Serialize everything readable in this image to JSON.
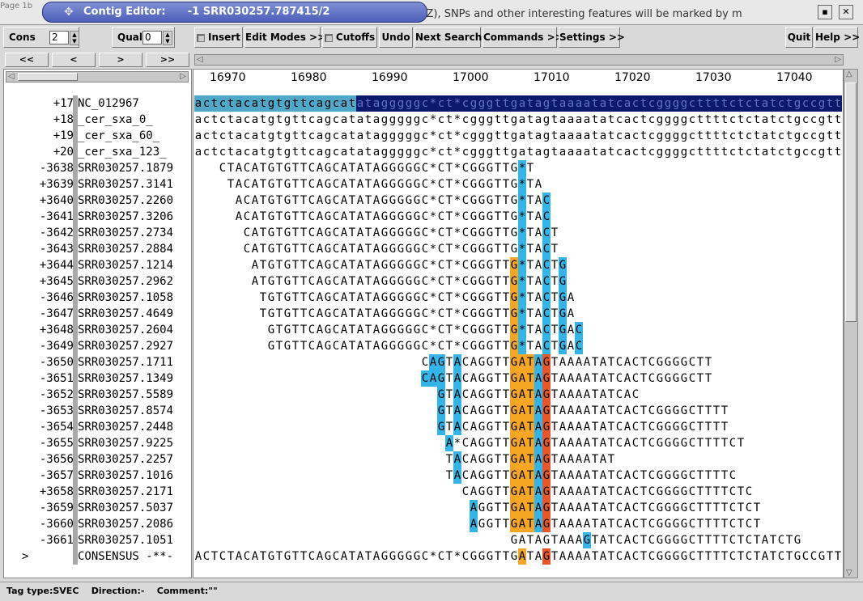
{
  "window": {
    "title": "Contig Editor:",
    "subtitle": "-1 SRR030257.787415/2",
    "background_text": "SEZ), SNPs and other interesting features will be marked by m",
    "background_left": "Page 1b"
  },
  "toolbar": {
    "cons_label": "Cons",
    "cons_value": "2",
    "qual_label": "Qual",
    "qual_value": "0",
    "insert_label": "Insert",
    "edit_modes_label": "Edit Modes >>",
    "cutoffs_label": "Cutoffs",
    "undo_label": "Undo",
    "next_search_label": "Next Search",
    "commands_label": "Commands >>",
    "settings_label": "Settings >>",
    "quit_label": "Quit",
    "help_label": "Help >>"
  },
  "nav": {
    "first": "<<",
    "prev": "<",
    "next": ">",
    "last": ">>"
  },
  "ruler": {
    "ticks": [
      "16970",
      "16980",
      "16990",
      "17000",
      "17010",
      "17020",
      "17030",
      "17040"
    ]
  },
  "rows": [
    {
      "num": "+17",
      "name": "NC_012967",
      "offset": 0,
      "seq": "actctacatgtgttcagcatatagggggc*ct*cgggttgatagtaaaatatcactcggggcttttctctatctgccgtt",
      "hl": [
        [
          0,
          20,
          "#4fa8c8"
        ],
        [
          20,
          81,
          "#0b1a6a"
        ]
      ],
      "color": "#000000"
    },
    {
      "num": "+18",
      "name": "_cer_sxa_0_",
      "offset": 0,
      "seq": "actctacatgtgttcagcatatagggggc*ct*cgggttgatagtaaaatatcactcggggcttttctctatctgccgtt",
      "hl": []
    },
    {
      "num": "+19",
      "name": "_cer_sxa_60_",
      "offset": 0,
      "seq": "actctacatgtgttcagcatatagggggc*ct*cgggttgatagtaaaatatcactcggggcttttctctatctgccgtt",
      "hl": []
    },
    {
      "num": "+20",
      "name": "_cer_sxa_123_",
      "offset": 0,
      "seq": "actctacatgtgttcagcatatagggggc*ct*cgggttgatagtaaaatatcactcggggcttttctctatctgccgtt",
      "hl": []
    },
    {
      "num": "-3638",
      "name": "SRR030257.1879",
      "offset": 3,
      "seq": "CTACATGTGTTCAGCATATAGGGGGC*CT*CGGGTTG*T",
      "hl": [
        [
          37,
          38,
          "#33b5e8"
        ]
      ]
    },
    {
      "num": "+3639",
      "name": "SRR030257.3141",
      "offset": 4,
      "seq": "TACATGTGTTCAGCATATAGGGGGC*CT*CGGGTTG*TA",
      "hl": [
        [
          36,
          37,
          "#33b5e8"
        ]
      ]
    },
    {
      "num": "+3640",
      "name": "SRR030257.2260",
      "offset": 5,
      "seq": "ACATGTGTTCAGCATATAGGGGGC*CT*CGGGTTG*TAC",
      "hl": [
        [
          35,
          36,
          "#33b5e8"
        ],
        [
          38,
          39,
          "#33b5e8"
        ]
      ]
    },
    {
      "num": "-3641",
      "name": "SRR030257.3206",
      "offset": 5,
      "seq": "ACATGTGTTCAGCATATAGGGGGC*CT*CGGGTTG*TAC",
      "hl": [
        [
          35,
          36,
          "#33b5e8"
        ],
        [
          38,
          39,
          "#33b5e8"
        ]
      ]
    },
    {
      "num": "-3642",
      "name": "SRR030257.2734",
      "offset": 6,
      "seq": "CATGTGTTCAGCATATAGGGGGC*CT*CGGGTTG*TACT",
      "hl": [
        [
          34,
          35,
          "#33b5e8"
        ],
        [
          37,
          38,
          "#33b5e8"
        ]
      ]
    },
    {
      "num": "-3643",
      "name": "SRR030257.2884",
      "offset": 6,
      "seq": "CATGTGTTCAGCATATAGGGGGC*CT*CGGGTTG*TACT",
      "hl": [
        [
          34,
          35,
          "#33b5e8"
        ],
        [
          37,
          38,
          "#33b5e8"
        ]
      ]
    },
    {
      "num": "+3644",
      "name": "SRR030257.1214",
      "offset": 7,
      "seq": "ATGTGTTCAGCATATAGGGGGC*CT*CGGGTTG*TACTG",
      "hl": [
        [
          32,
          33,
          "#f5a623"
        ],
        [
          33,
          34,
          "#33b5e8"
        ],
        [
          36,
          37,
          "#33b5e8"
        ],
        [
          38,
          39,
          "#33b5e8"
        ]
      ]
    },
    {
      "num": "+3645",
      "name": "SRR030257.2962",
      "offset": 7,
      "seq": "ATGTGTTCAGCATATAGGGGGC*CT*CGGGTTG*TACTG",
      "hl": [
        [
          32,
          33,
          "#f5a623"
        ],
        [
          33,
          34,
          "#33b5e8"
        ],
        [
          36,
          37,
          "#33b5e8"
        ],
        [
          38,
          39,
          "#33b5e8"
        ]
      ]
    },
    {
      "num": "-3646",
      "name": "SRR030257.1058",
      "offset": 8,
      "seq": "TGTGTTCAGCATATAGGGGGC*CT*CGGGTTG*TACTGA",
      "hl": [
        [
          31,
          32,
          "#f5a623"
        ],
        [
          32,
          33,
          "#33b5e8"
        ],
        [
          35,
          36,
          "#33b5e8"
        ],
        [
          37,
          38,
          "#33b5e8"
        ]
      ]
    },
    {
      "num": "-3647",
      "name": "SRR030257.4649",
      "offset": 8,
      "seq": "TGTGTTCAGCATATAGGGGGC*CT*CGGGTTG*TACTGA",
      "hl": [
        [
          31,
          32,
          "#f5a623"
        ],
        [
          32,
          33,
          "#33b5e8"
        ],
        [
          35,
          36,
          "#33b5e8"
        ],
        [
          37,
          38,
          "#33b5e8"
        ]
      ]
    },
    {
      "num": "+3648",
      "name": "SRR030257.2604",
      "offset": 9,
      "seq": "GTGTTCAGCATATAGGGGGC*CT*CGGGTTG*TACTGAC",
      "hl": [
        [
          30,
          31,
          "#f5a623"
        ],
        [
          31,
          32,
          "#33b5e8"
        ],
        [
          34,
          35,
          "#33b5e8"
        ],
        [
          36,
          37,
          "#33b5e8"
        ],
        [
          38,
          39,
          "#33b5e8"
        ]
      ]
    },
    {
      "num": "-3649",
      "name": "SRR030257.2927",
      "offset": 9,
      "seq": "GTGTTCAGCATATAGGGGGC*CT*CGGGTTG*TACTGAC",
      "hl": [
        [
          30,
          31,
          "#f5a623"
        ],
        [
          31,
          32,
          "#33b5e8"
        ],
        [
          34,
          35,
          "#33b5e8"
        ],
        [
          36,
          37,
          "#33b5e8"
        ],
        [
          38,
          39,
          "#33b5e8"
        ]
      ]
    },
    {
      "num": "-3650",
      "name": "SRR030257.1711",
      "offset": 28,
      "seq": "CAGTACAGGTTGATAGTAAAATATCACTCGGGGCTT",
      "hl": [
        [
          1,
          3,
          "#33b5e8"
        ],
        [
          4,
          5,
          "#33b5e8"
        ],
        [
          11,
          14,
          "#f5a623"
        ],
        [
          14,
          15,
          "#33b5e8"
        ],
        [
          15,
          16,
          "#e8562a"
        ]
      ]
    },
    {
      "num": "-3651",
      "name": "SRR030257.1349",
      "offset": 28,
      "seq": "CAGTACAGGTTGATAGTAAAATATCACTCGGGGCTT",
      "hl": [
        [
          0,
          1,
          "#33b5e8"
        ],
        [
          1,
          3,
          "#33b5e8"
        ],
        [
          4,
          5,
          "#33b5e8"
        ],
        [
          11,
          14,
          "#f5a623"
        ],
        [
          14,
          15,
          "#33b5e8"
        ],
        [
          15,
          16,
          "#e8562a"
        ]
      ]
    },
    {
      "num": "-3652",
      "name": "SRR030257.5589",
      "offset": 30,
      "seq": "GTACAGGTTGATAGTAAAATATCAC",
      "hl": [
        [
          0,
          1,
          "#33b5e8"
        ],
        [
          2,
          3,
          "#33b5e8"
        ],
        [
          9,
          12,
          "#f5a623"
        ],
        [
          12,
          13,
          "#33b5e8"
        ],
        [
          13,
          14,
          "#e8562a"
        ]
      ]
    },
    {
      "num": "-3653",
      "name": "SRR030257.8574",
      "offset": 30,
      "seq": "GTACAGGTTGATAGTAAAATATCACTCGGGGCTTTT",
      "hl": [
        [
          0,
          1,
          "#33b5e8"
        ],
        [
          2,
          3,
          "#33b5e8"
        ],
        [
          9,
          12,
          "#f5a623"
        ],
        [
          12,
          13,
          "#33b5e8"
        ],
        [
          13,
          14,
          "#e8562a"
        ]
      ]
    },
    {
      "num": "-3654",
      "name": "SRR030257.2448",
      "offset": 30,
      "seq": "GTACAGGTTGATAGTAAAATATCACTCGGGGCTTTT",
      "hl": [
        [
          0,
          1,
          "#33b5e8"
        ],
        [
          2,
          3,
          "#33b5e8"
        ],
        [
          9,
          12,
          "#f5a623"
        ],
        [
          12,
          13,
          "#33b5e8"
        ],
        [
          13,
          14,
          "#e8562a"
        ]
      ]
    },
    {
      "num": "-3655",
      "name": "SRR030257.9225",
      "offset": 31,
      "seq": "A*CAGGTTGATAGTAAAATATCACTCGGGGCTTTTCT",
      "hl": [
        [
          0,
          1,
          "#33b5e8"
        ],
        [
          8,
          11,
          "#f5a623"
        ],
        [
          11,
          12,
          "#33b5e8"
        ],
        [
          12,
          13,
          "#e8562a"
        ]
      ]
    },
    {
      "num": "-3656",
      "name": "SRR030257.2257",
      "offset": 31,
      "seq": "TACAGGTTGATAGTAAAATAT",
      "hl": [
        [
          1,
          2,
          "#33b5e8"
        ],
        [
          8,
          11,
          "#f5a623"
        ],
        [
          11,
          12,
          "#33b5e8"
        ],
        [
          12,
          13,
          "#e8562a"
        ]
      ]
    },
    {
      "num": "-3657",
      "name": "SRR030257.1016",
      "offset": 31,
      "seq": "TACAGGTTGATAGTAAAATATCACTCGGGGCTTTTC",
      "hl": [
        [
          1,
          2,
          "#33b5e8"
        ],
        [
          8,
          11,
          "#f5a623"
        ],
        [
          11,
          12,
          "#33b5e8"
        ],
        [
          12,
          13,
          "#e8562a"
        ]
      ]
    },
    {
      "num": "+3658",
      "name": "SRR030257.2171",
      "offset": 33,
      "seq": "CAGGTTGATAGTAAAATATCACTCGGGGCTTTTCTC",
      "hl": [
        [
          6,
          9,
          "#f5a623"
        ],
        [
          9,
          10,
          "#33b5e8"
        ],
        [
          10,
          11,
          "#e8562a"
        ]
      ]
    },
    {
      "num": "-3659",
      "name": "SRR030257.5037",
      "offset": 34,
      "seq": "AGGTTGATAGTAAAATATCACTCGGGGCTTTTCTCT",
      "hl": [
        [
          0,
          1,
          "#33b5e8"
        ],
        [
          5,
          8,
          "#f5a623"
        ],
        [
          8,
          9,
          "#33b5e8"
        ],
        [
          9,
          10,
          "#e8562a"
        ]
      ]
    },
    {
      "num": "-3660",
      "name": "SRR030257.2086",
      "offset": 34,
      "seq": "AGGTTGATAGTAAAATATCACTCGGGGCTTTTCTCT",
      "hl": [
        [
          0,
          1,
          "#33b5e8"
        ],
        [
          5,
          8,
          "#f5a623"
        ],
        [
          8,
          9,
          "#33b5e8"
        ],
        [
          9,
          10,
          "#e8562a"
        ]
      ]
    },
    {
      "num": "-3661",
      "name": "SRR030257.1051",
      "offset": 39,
      "seq": "GATAGTAAAGTATCACTCGGGGCTTTTCTCTATCTG",
      "hl": [
        [
          9,
          10,
          "#33b5e8"
        ]
      ]
    }
  ],
  "consensus": {
    "marker": ">",
    "name": "CONSENSUS",
    "mark": "-**-",
    "seq": "ACTCTACATGTGTTCAGCATATAGGGGGC*CT*CGGGTTGATAGTAAAATATCACTCGGGGCTTTTCTCTATCTGCCGTT",
    "hl": [
      [
        40,
        41,
        "#f5a623"
      ],
      [
        43,
        44,
        "#e8562a"
      ]
    ]
  },
  "status": {
    "tag_type": "Tag type:SVEC",
    "direction": "Direction:-",
    "comment": "Comment:\"\""
  }
}
